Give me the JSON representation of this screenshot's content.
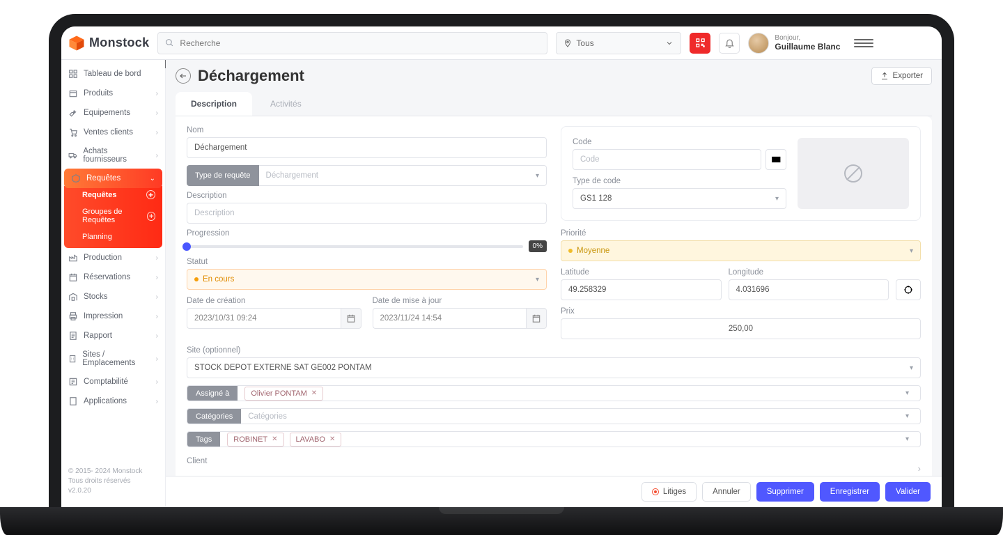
{
  "brand": "Monstock",
  "header": {
    "search_placeholder": "Recherche",
    "filter_value": "Tous",
    "greeting": "Bonjour,",
    "user_name": "Guillaume Blanc"
  },
  "sidebar": {
    "items": [
      {
        "label": "Tableau de bord",
        "expandable": false
      },
      {
        "label": "Produits",
        "expandable": true
      },
      {
        "label": "Equipements",
        "expandable": true
      },
      {
        "label": "Ventes clients",
        "expandable": true
      },
      {
        "label": "Achats fournisseurs",
        "expandable": true
      },
      {
        "label": "Requêtes",
        "expandable": true,
        "active": true
      },
      {
        "label": "Production",
        "expandable": true
      },
      {
        "label": "Réservations",
        "expandable": true
      },
      {
        "label": "Stocks",
        "expandable": true
      },
      {
        "label": "Impression",
        "expandable": true
      },
      {
        "label": "Rapport",
        "expandable": true
      },
      {
        "label": "Sites / Emplacements",
        "expandable": true
      },
      {
        "label": "Comptabilité",
        "expandable": true
      },
      {
        "label": "Applications",
        "expandable": true
      }
    ],
    "sub_items": [
      {
        "label": "Requêtes",
        "current": true,
        "add": true
      },
      {
        "label": "Groupes de Requêtes",
        "add": true
      },
      {
        "label": "Planning",
        "add": false
      }
    ],
    "footer": {
      "l1": "© 2015- 2024 Monstock",
      "l2": "Tous droits réservés",
      "l3": "v2.0.20"
    }
  },
  "page": {
    "title": "Déchargement",
    "export": "Exporter",
    "tabs": [
      "Description",
      "Activités"
    ],
    "labels": {
      "nom": "Nom",
      "type_requete": "Type de requête",
      "description": "Description",
      "description_ph": "Description",
      "progression": "Progression",
      "statut": "Statut",
      "date_creation": "Date de création",
      "date_maj": "Date de mise à jour",
      "code": "Code",
      "code_ph": "Code",
      "type_code": "Type de code",
      "priorite": "Priorité",
      "latitude": "Latitude",
      "longitude": "Longitude",
      "prix": "Prix",
      "site": "Site (optionnel)",
      "assigne": "Assigné à",
      "categories": "Catégories",
      "categories_ph": "Catégories",
      "tags": "Tags",
      "client": "Client"
    },
    "values": {
      "nom": "Déchargement",
      "type_requete": "Déchargement",
      "progression": "0%",
      "statut": "En cours",
      "date_creation": "2023/10/31 09:24",
      "date_maj": "2023/11/24 14:54",
      "type_code": "GS1 128",
      "priorite": "Moyenne",
      "latitude": "49.258329",
      "longitude": "4.031696",
      "prix": "250,00",
      "site": "STOCK DEPOT EXTERNE SAT GE002 PONTAM",
      "assigne": [
        "Olivier PONTAM"
      ],
      "tags": [
        "ROBINET",
        "LAVABO"
      ]
    },
    "actions": {
      "litiges": "Litiges",
      "annuler": "Annuler",
      "supprimer": "Supprimer",
      "enregistrer": "Enregistrer",
      "valider": "Valider"
    }
  }
}
